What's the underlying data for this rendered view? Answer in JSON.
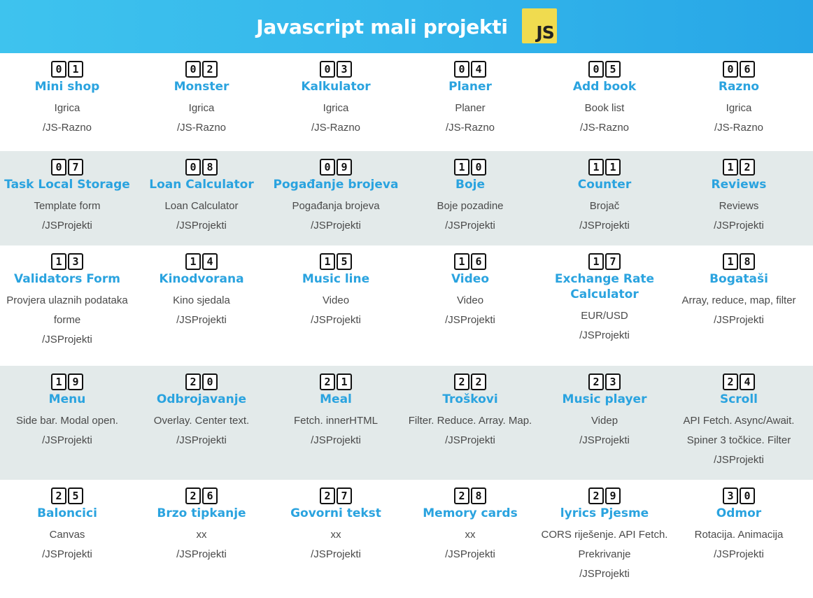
{
  "header": {
    "title": "Javascript mali projekti",
    "logo_text": "JS"
  },
  "rows": [
    [
      {
        "num": [
          "0",
          "1"
        ],
        "title": "Mini shop",
        "desc": "Igrica",
        "path": "/JS-Razno"
      },
      {
        "num": [
          "0",
          "2"
        ],
        "title": "Monster",
        "desc": "Igrica",
        "path": "/JS-Razno"
      },
      {
        "num": [
          "0",
          "3"
        ],
        "title": "Kalkulator",
        "desc": "Igrica",
        "path": "/JS-Razno"
      },
      {
        "num": [
          "0",
          "4"
        ],
        "title": "Planer",
        "desc": "Planer",
        "path": "/JS-Razno"
      },
      {
        "num": [
          "0",
          "5"
        ],
        "title": "Add book",
        "desc": "Book list",
        "path": "/JS-Razno"
      },
      {
        "num": [
          "0",
          "6"
        ],
        "title": "Razno",
        "desc": "Igrica",
        "path": "/JS-Razno"
      }
    ],
    [
      {
        "num": [
          "0",
          "7"
        ],
        "title": "Task Local Storage",
        "desc": "Template form",
        "path": "/JSProjekti"
      },
      {
        "num": [
          "0",
          "8"
        ],
        "title": "Loan Calculator",
        "desc": "Loan Calculator",
        "path": "/JSProjekti"
      },
      {
        "num": [
          "0",
          "9"
        ],
        "title": "Pogađanje brojeva",
        "desc": "Pogađanja brojeva",
        "path": "/JSProjekti"
      },
      {
        "num": [
          "1",
          "0"
        ],
        "title": "Boje",
        "desc": "Boje pozadine",
        "path": "/JSProjekti"
      },
      {
        "num": [
          "1",
          "1"
        ],
        "title": "Counter",
        "desc": "Brojač",
        "path": "/JSProjekti"
      },
      {
        "num": [
          "1",
          "2"
        ],
        "title": "Reviews",
        "desc": "Reviews",
        "path": "/JSProjekti"
      }
    ],
    [
      {
        "num": [
          "1",
          "3"
        ],
        "title": "Validators Form",
        "desc": "Provjera ulaznih podataka forme",
        "path": "/JSProjekti"
      },
      {
        "num": [
          "1",
          "4"
        ],
        "title": "Kinodvorana",
        "desc": "Kino sjedala",
        "path": "/JSProjekti"
      },
      {
        "num": [
          "1",
          "5"
        ],
        "title": "Music line",
        "desc": "Video",
        "path": "/JSProjekti"
      },
      {
        "num": [
          "1",
          "6"
        ],
        "title": "Video",
        "desc": "Video",
        "path": "/JSProjekti"
      },
      {
        "num": [
          "1",
          "7"
        ],
        "title": "Exchange Rate Calculator",
        "desc": "EUR/USD",
        "path": "/JSProjekti"
      },
      {
        "num": [
          "1",
          "8"
        ],
        "title": "Bogataši",
        "desc": "Array, reduce, map, filter",
        "path": "/JSProjekti"
      }
    ],
    [
      {
        "num": [
          "1",
          "9"
        ],
        "title": "Menu",
        "desc": "Side bar. Modal open.",
        "path": "/JSProjekti"
      },
      {
        "num": [
          "2",
          "0"
        ],
        "title": "Odbrojavanje",
        "desc": "Overlay. Center text.",
        "path": "/JSProjekti"
      },
      {
        "num": [
          "2",
          "1"
        ],
        "title": "Meal",
        "desc": "Fetch. innerHTML",
        "path": "/JSProjekti"
      },
      {
        "num": [
          "2",
          "2"
        ],
        "title": "Troškovi",
        "desc": "Filter. Reduce. Array. Map.",
        "path": "/JSProjekti"
      },
      {
        "num": [
          "2",
          "3"
        ],
        "title": "Music player",
        "desc": "Videp",
        "path": "/JSProjekti"
      },
      {
        "num": [
          "2",
          "4"
        ],
        "title": "Scroll",
        "desc": "API Fetch. Async/Await. Spiner 3 točkice. Filter",
        "path": "/JSProjekti"
      }
    ],
    [
      {
        "num": [
          "2",
          "5"
        ],
        "title": "Baloncici",
        "desc": "Canvas",
        "path": "/JSProjekti"
      },
      {
        "num": [
          "2",
          "6"
        ],
        "title": "Brzo tipkanje",
        "desc": "xx",
        "path": "/JSProjekti"
      },
      {
        "num": [
          "2",
          "7"
        ],
        "title": "Govorni tekst",
        "desc": "xx",
        "path": "/JSProjekti"
      },
      {
        "num": [
          "2",
          "8"
        ],
        "title": "Memory cards",
        "desc": "xx",
        "path": "/JSProjekti"
      },
      {
        "num": [
          "2",
          "9"
        ],
        "title": "lyrics Pjesme",
        "desc": "CORS riješenje. API Fetch. Prekrivanje",
        "path": "/JSProjekti"
      },
      {
        "num": [
          "3",
          "0"
        ],
        "title": "Odmor",
        "desc": "Rotacija. Animacija",
        "path": "/JSProjekti"
      }
    ]
  ]
}
